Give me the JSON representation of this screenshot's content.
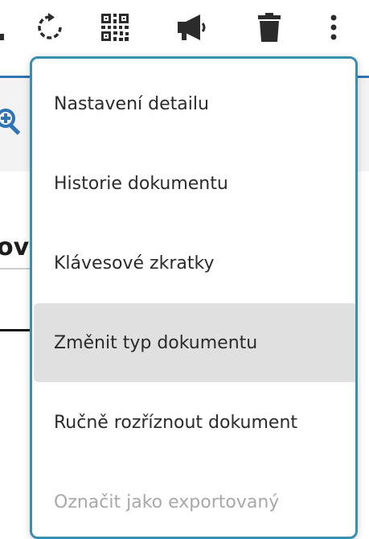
{
  "toolbar": {
    "icons": [
      "refresh-icon",
      "qr-code-icon",
      "megaphone-icon",
      "trash-icon",
      "more-vertical-icon"
    ]
  },
  "background": {
    "partial_heading": "ov"
  },
  "menu": {
    "items": [
      {
        "label": "Nastavení detailu",
        "state": "normal"
      },
      {
        "label": "Historie dokumentu",
        "state": "normal"
      },
      {
        "label": "Klávesové zkratky",
        "state": "normal"
      },
      {
        "label": "Změnit typ dokumentu",
        "state": "hovered"
      },
      {
        "label": "Ručně rozříznout dokument",
        "state": "normal"
      },
      {
        "label": "Označit jako exportovaný",
        "state": "disabled"
      }
    ]
  },
  "colors": {
    "accent": "#2f74b5",
    "menu_border": "#3a8fb0",
    "hover_bg": "#e0e0e0",
    "icon_color": "#2b2b2b",
    "disabled_text": "#a8a8a8"
  }
}
